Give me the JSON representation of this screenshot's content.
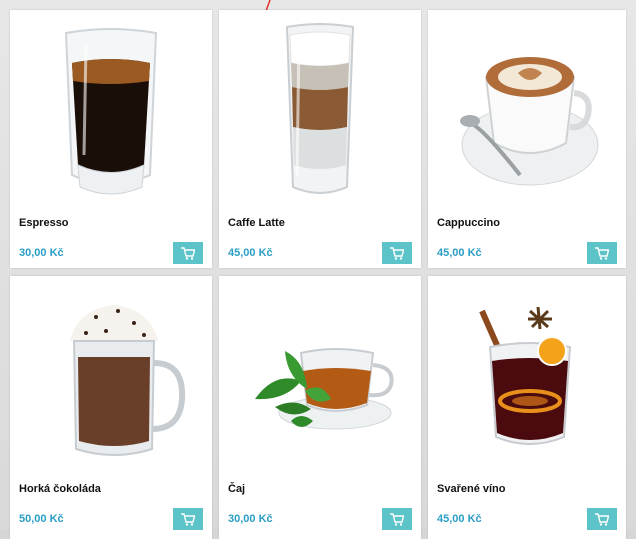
{
  "products": [
    {
      "name": "Espresso",
      "price": "30,00 Kč",
      "image": "espresso-glass"
    },
    {
      "name": "Caffe Latte",
      "price": "45,00 Kč",
      "image": "latte-glass"
    },
    {
      "name": "Cappuccino",
      "price": "45,00 Kč",
      "image": "cappuccino-cup"
    },
    {
      "name": "Horká čokoláda",
      "price": "50,00 Kč",
      "image": "hot-chocolate-mug"
    },
    {
      "name": "Čaj",
      "price": "30,00 Kč",
      "image": "tea-cup"
    },
    {
      "name": "Svařené víno",
      "price": "45,00 Kč",
      "image": "mulled-wine-glass"
    }
  ],
  "colors": {
    "price": "#2a9ec5",
    "cart_button": "#5cc3c9",
    "pointer": "#e0302b"
  },
  "icons": {
    "cart": "shopping-cart-icon",
    "pointer": "red-arrow-pointer"
  }
}
